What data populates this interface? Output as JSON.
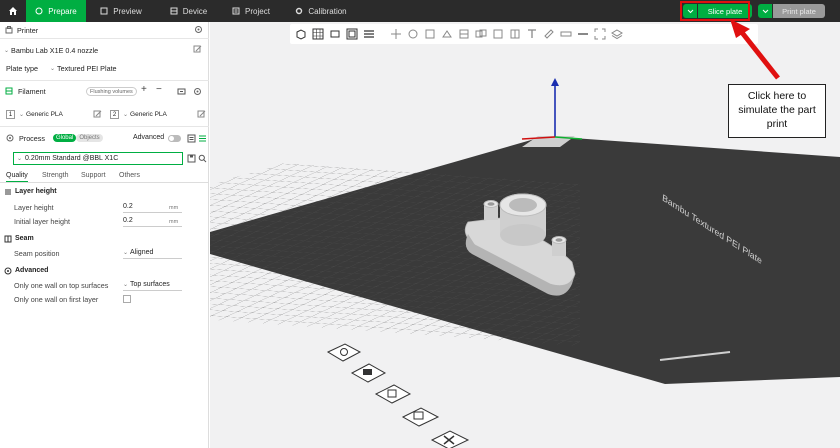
{
  "topbar": {
    "tabs": [
      {
        "label": "Prepare"
      },
      {
        "label": "Preview"
      },
      {
        "label": "Device"
      },
      {
        "label": "Project"
      },
      {
        "label": "Calibration"
      }
    ],
    "slice_label": "Slice plate",
    "print_label": "Print plate"
  },
  "sidebar": {
    "printer_title": "Printer",
    "printer_name": "Bambu Lab X1E 0.4 nozzle",
    "plate_type_label": "Plate type",
    "plate_type_value": "Textured PEI Plate",
    "filament_title": "Filament",
    "flushing_label": "Flushing volumes",
    "filaments": [
      {
        "index": "1",
        "name": "Generic PLA"
      },
      {
        "index": "2",
        "name": "Generic PLA"
      }
    ],
    "process_title": "Process",
    "global_label": "Global",
    "objects_label": "Objects",
    "advanced_label": "Advanced",
    "profile_value": "0.20mm Standard @BBL X1C",
    "subtabs": [
      "Quality",
      "Strength",
      "Support",
      "Others"
    ],
    "layer_height_section": "Layer height",
    "layer_height_label": "Layer height",
    "layer_height_value": "0.2",
    "initial_layer_label": "Initial layer height",
    "initial_layer_value": "0.2",
    "unit": "mm",
    "seam_section": "Seam",
    "seam_position_label": "Seam position",
    "seam_position_value": "Aligned",
    "advanced_section": "Advanced",
    "one_wall_top_label": "Only one wall on top surfaces",
    "one_wall_top_value": "Top surfaces",
    "one_wall_first_label": "Only one wall on first layer"
  },
  "viewport": {
    "plate_text": "Bambu Textured PEI Plate"
  },
  "annotation": {
    "callout_text": "Click here to simulate the part print",
    "color": "#e01010"
  },
  "colors": {
    "accent": "#00ae42",
    "topbar": "#2b2b2b",
    "plate": "#3a3a3a"
  }
}
